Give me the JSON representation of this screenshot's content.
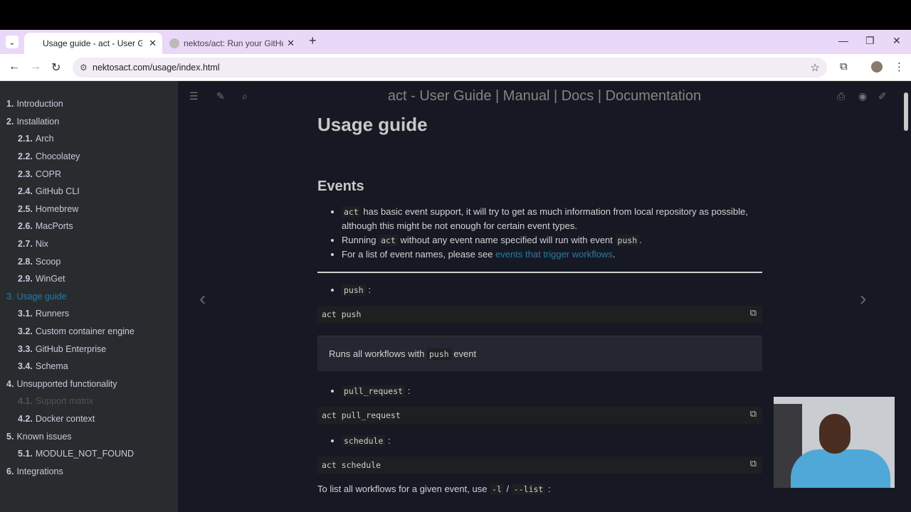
{
  "browser": {
    "tabs": [
      {
        "label": "Usage guide - act - User Guide",
        "active": true
      },
      {
        "label": "nektos/act: Run your GitHub Ac",
        "active": false
      }
    ],
    "new_tab": "+",
    "url": "nektosact.com/usage/index.html"
  },
  "sidebar": {
    "items": [
      {
        "num": "1.",
        "label": "Introduction",
        "level": 1
      },
      {
        "num": "2.",
        "label": "Installation",
        "level": 1
      },
      {
        "num": "2.1.",
        "label": "Arch",
        "level": 2
      },
      {
        "num": "2.2.",
        "label": "Chocolatey",
        "level": 2
      },
      {
        "num": "2.3.",
        "label": "COPR",
        "level": 2
      },
      {
        "num": "2.4.",
        "label": "GitHub CLI",
        "level": 2
      },
      {
        "num": "2.5.",
        "label": "Homebrew",
        "level": 2
      },
      {
        "num": "2.6.",
        "label": "MacPorts",
        "level": 2
      },
      {
        "num": "2.7.",
        "label": "Nix",
        "level": 2
      },
      {
        "num": "2.8.",
        "label": "Scoop",
        "level": 2
      },
      {
        "num": "2.9.",
        "label": "WinGet",
        "level": 2
      },
      {
        "num": "3.",
        "label": "Usage guide",
        "level": 1
      },
      {
        "num": "3.1.",
        "label": "Runners",
        "level": 2
      },
      {
        "num": "3.2.",
        "label": "Custom container engine",
        "level": 2
      },
      {
        "num": "3.3.",
        "label": "GitHub Enterprise",
        "level": 2
      },
      {
        "num": "3.4.",
        "label": "Schema",
        "level": 2
      },
      {
        "num": "4.",
        "label": "Unsupported functionality",
        "level": 1
      },
      {
        "num": "4.1.",
        "label": "Support matrix",
        "level": 2
      },
      {
        "num": "4.2.",
        "label": "Docker context",
        "level": 2
      },
      {
        "num": "5.",
        "label": "Known issues",
        "level": 1
      },
      {
        "num": "5.1.",
        "label": "MODULE_NOT_FOUND",
        "level": 2
      },
      {
        "num": "6.",
        "label": "Integrations",
        "level": 1
      }
    ]
  },
  "menubar": {
    "title": "act - User Guide | Manual | Docs | Documentation"
  },
  "content": {
    "h1": "Usage guide",
    "h2": "Events",
    "b1_code": "act",
    "b1_text": "has basic event support, it will try to get as much information from local repository as possible, although this might be not enough for certain event types.",
    "b2_pre": "Running",
    "b2_code": "act",
    "b2_mid": "without any event name specified will run with event",
    "b2_code2": "push",
    "b2_end": ".",
    "b3_pre": "For a list of event names, please see",
    "b3_link": "events that trigger workflows",
    "b3_end": ".",
    "e1_code": "push",
    "e1_colon": ":",
    "cmd1": "act push",
    "quote_pre": "Runs all workflows with",
    "quote_code": "push",
    "quote_end": "event",
    "e2_code": "pull_request",
    "e2_colon": ":",
    "cmd2": "act pull_request",
    "e3_code": "schedule",
    "e3_colon": ":",
    "cmd3": "act schedule",
    "last_pre": "To list all workflows for a given event, use",
    "last_code1": "-l",
    "last_sep": "/",
    "last_code2": "--list",
    "last_end": ":"
  }
}
